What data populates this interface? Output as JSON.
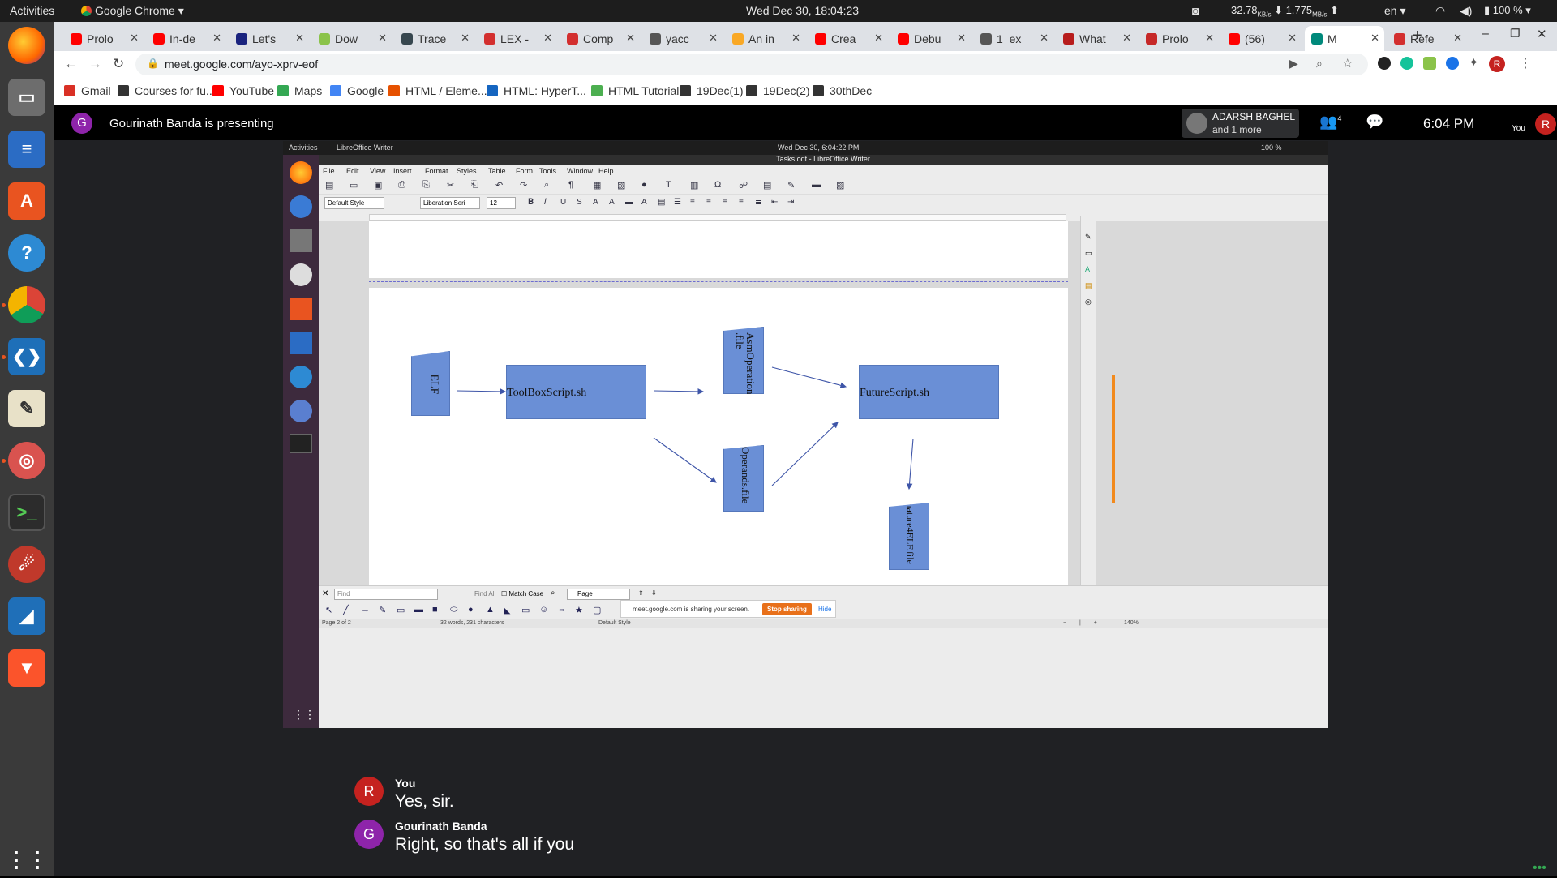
{
  "topbar": {
    "activities": "Activities",
    "app": "Google Chrome",
    "datetime": "Wed Dec 30, 18:04:23",
    "net_down": "32.78",
    "net_down_unit": "KB/s",
    "net_up": "1.775",
    "net_up_unit": "MB/s",
    "lang": "en",
    "battery": "100 %"
  },
  "launcher": {
    "items": [
      "Firefox",
      "Files",
      "Writer",
      "Software",
      "Help",
      "Chrome",
      "VS Code",
      "Editor",
      "Screenshot",
      "Terminal",
      "Tool",
      "Wireshark",
      "Brave",
      "Apps"
    ]
  },
  "tabs": [
    {
      "label": "Prolo",
      "color": "#ff0000"
    },
    {
      "label": "In-de",
      "color": "#ff0000"
    },
    {
      "label": "Let's",
      "color": "#1a237e"
    },
    {
      "label": "Dow",
      "color": "#8bc34a"
    },
    {
      "label": "Trace",
      "color": "#37474f"
    },
    {
      "label": "LEX -",
      "color": "#d32f2f"
    },
    {
      "label": "Comp",
      "color": "#d32f2f"
    },
    {
      "label": "yacc",
      "color": "#555555"
    },
    {
      "label": "An in",
      "color": "#f9a825"
    },
    {
      "label": "Crea",
      "color": "#ff0000"
    },
    {
      "label": "Debu",
      "color": "#ff0000"
    },
    {
      "label": "1_ex",
      "color": "#555555"
    },
    {
      "label": "What",
      "color": "#b71c1c"
    },
    {
      "label": "Prolo",
      "color": "#c62828"
    },
    {
      "label": "(56)",
      "color": "#ff0000"
    },
    {
      "label": "M",
      "color": "#00897b"
    },
    {
      "label": "Refe",
      "color": "#d32f2f"
    }
  ],
  "address": {
    "url": "meet.google.com/ayo-xprv-eof",
    "profile_letter": "R"
  },
  "bookmarks": [
    {
      "label": "Gmail",
      "color": "#d93025"
    },
    {
      "label": "Courses for fu...",
      "color": "#333333"
    },
    {
      "label": "YouTube",
      "color": "#ff0000"
    },
    {
      "label": "Maps",
      "color": "#34a853"
    },
    {
      "label": "Google",
      "color": "#4285f4"
    },
    {
      "label": "HTML / Eleme...",
      "color": "#e65100"
    },
    {
      "label": "HTML: HyperT...",
      "color": "#1565c0"
    },
    {
      "label": "HTML Tutorial",
      "color": "#4caf50"
    },
    {
      "label": "19Dec(1)",
      "color": "#333333"
    },
    {
      "label": "19Dec(2)",
      "color": "#333333"
    },
    {
      "label": "30thDec",
      "color": "#333333"
    }
  ],
  "meet": {
    "presenter_letter": "G",
    "presenting_text": "Gourinath Banda is presenting",
    "participant_name": "ADARSH BAGHEL",
    "participant_more": "and 1 more",
    "people_count": "4",
    "time": "6:04 PM",
    "you_label": "You",
    "you_letter": "R"
  },
  "shared": {
    "topbar_activities": "Activities",
    "topbar_app": "LibreOffice Writer",
    "topbar_datetime": "Wed Dec 30,  6:04:22 PM",
    "topbar_battery": "100 %",
    "window_title": "Tasks.odt - LibreOffice Writer",
    "menu": [
      "File",
      "Edit",
      "View",
      "Insert",
      "Format",
      "Styles",
      "Table",
      "Form",
      "Tools",
      "Window",
      "Help"
    ],
    "style_value": "Default Style",
    "font_value": "Liberation Seri",
    "size_value": "12",
    "find_placeholder": "Find",
    "find_all": "Find All",
    "match_case": "Match Case",
    "page_select": "Page",
    "sharing_text": "meet.google.com is sharing your screen.",
    "stop_sharing": "Stop sharing",
    "hide": "Hide",
    "status_page": "Page 2 of 2",
    "status_words": "32 words, 231 characters",
    "status_style": "Default Style",
    "status_zoom": "140%",
    "diagram": {
      "elf": "ELF",
      "toolbox": "ToolBoxScript.sh",
      "asm": "AsmOperations .file",
      "future": "FutureScript.sh",
      "operands": "Operands.file",
      "signature": "signature4ELF.file"
    }
  },
  "captions": [
    {
      "letter": "R",
      "name": "You",
      "text": "Yes, sir.",
      "color": "#c5221f"
    },
    {
      "letter": "G",
      "name": "Gourinath Banda",
      "text": "Right, so that's all if you",
      "color": "#8e24aa"
    }
  ]
}
